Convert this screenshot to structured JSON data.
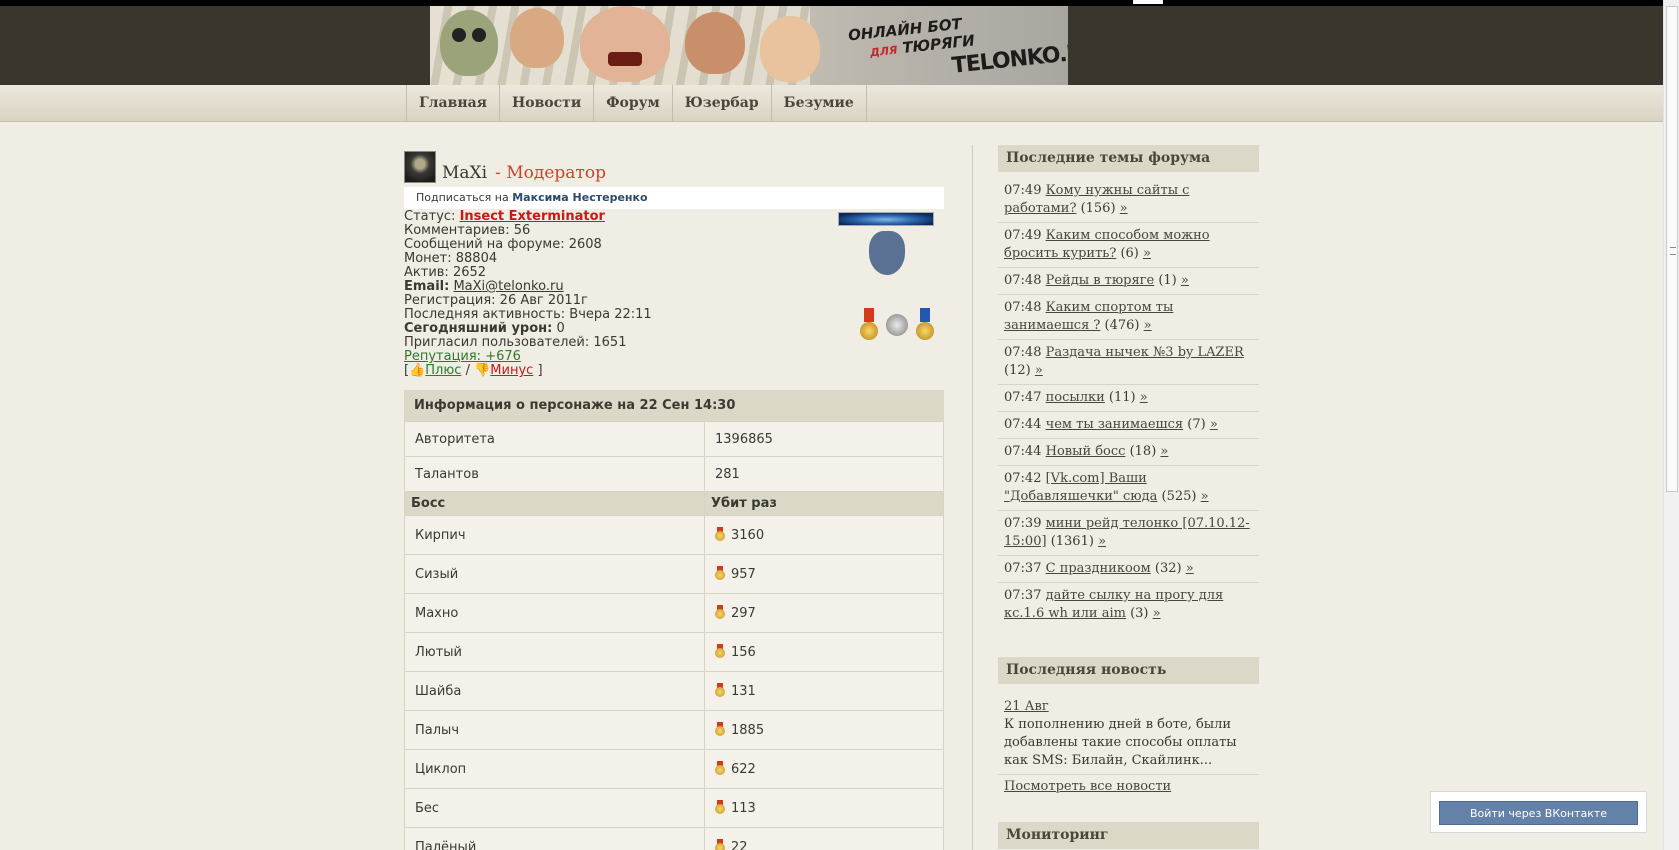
{
  "nav": [
    "Главная",
    "Новости",
    "Форум",
    "Юзербар",
    "Безумие"
  ],
  "banner": {
    "line1": "ОНЛАЙН БОТ",
    "line2_pre": "ДЛЯ",
    "line2": "ТЮРЯГИ",
    "brand": "TELONKO.RU"
  },
  "profile": {
    "name": "MaXi",
    "role": "- Модератор",
    "subscribe_prefix": "Подписаться на",
    "subscribe_name": "Максима Нестеренко",
    "status_label": "Статус:",
    "status_value": "Insect Exterminator",
    "comments": "Комментариев: 56",
    "forum_posts": "Сообщений на форуме: 2608",
    "coins": "Монет: 88804",
    "active": "Актив: 2652",
    "email_label": "Email:",
    "email": "MaXi@telonko.ru",
    "registration": "Регистрация: 26 Авг 2011г",
    "last_activity": "Последняя активность: Вчера 22:11",
    "today_damage_label": "Сегодняшний урон:",
    "today_damage": "0",
    "invited": "Пригласил пользователей: 1651",
    "reputation": "Репутация: +676",
    "plus": "Плюс",
    "minus": "Минус"
  },
  "info": {
    "title": "Информация о персонаже на 22 Сен 14:30",
    "rows": [
      {
        "k": "Авторитета",
        "v": "1396865"
      },
      {
        "k": "Талантов",
        "v": "281"
      }
    ],
    "boss_header": "Босс",
    "kills_header": "Убит раз",
    "bosses": [
      {
        "name": "Кирпич",
        "kills": "3160"
      },
      {
        "name": "Сизый",
        "kills": "957"
      },
      {
        "name": "Махно",
        "kills": "297"
      },
      {
        "name": "Лютый",
        "kills": "156"
      },
      {
        "name": "Шайба",
        "kills": "131"
      },
      {
        "name": "Палыч",
        "kills": "1885"
      },
      {
        "name": "Циклоп",
        "kills": "622"
      },
      {
        "name": "Бес",
        "kills": "113"
      },
      {
        "name": "Палёный",
        "kills": "22"
      }
    ]
  },
  "sidebar": {
    "forum_title": "Последние темы форума",
    "topics": [
      {
        "time": "07:49",
        "title": "Кому нужны сайты с работами?",
        "count": "(156)"
      },
      {
        "time": "07:49",
        "title": "Каким способом можно бросить курить?",
        "count": "(6)"
      },
      {
        "time": "07:48",
        "title": "Рейды в тюряге",
        "count": "(1)"
      },
      {
        "time": "07:48",
        "title": "Каким спортом ты занимаешся ?",
        "count": "(476)"
      },
      {
        "time": "07:48",
        "title": "Раздача нычек №3 by LAZER",
        "count": "(12)"
      },
      {
        "time": "07:47",
        "title": "посылки",
        "count": "(11)"
      },
      {
        "time": "07:44",
        "title": "чем ты занимаешся",
        "count": "(7)"
      },
      {
        "time": "07:44",
        "title": "Новый босс",
        "count": "(18)"
      },
      {
        "time": "07:42",
        "title": "[Vk.com] Ваши \"Добавляшечки\" сюда",
        "count": "(525)"
      },
      {
        "time": "07:39",
        "title": "мини рейд телонко [07.10.12-15:00]",
        "count": "(1361)"
      },
      {
        "time": "07:37",
        "title": "С праздникоом",
        "count": "(32)"
      },
      {
        "time": "07:37",
        "title": "дайте сылку на прогу для кс.1.6 wh или aim",
        "count": "(3)"
      }
    ],
    "news_title": "Последняя новость",
    "news_date": "21 Авг",
    "news_text": "К пополнению дней в боте, были добавлены такие способы оплаты как SMS: Билайн, Скайлинк...",
    "all_news": "Посмотреть все новости",
    "monitoring_title": "Мониторинг"
  },
  "vk_button": "Войти через ВКонтакте"
}
